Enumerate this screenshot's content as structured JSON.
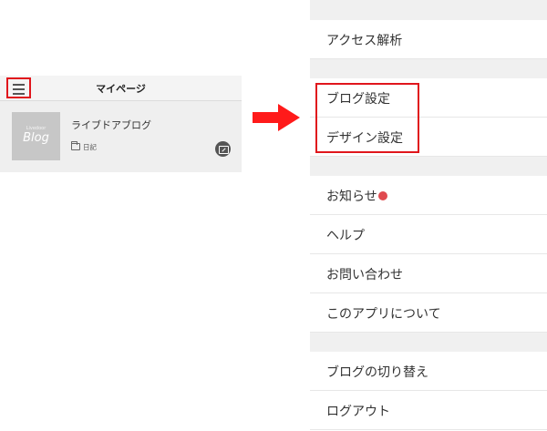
{
  "left": {
    "header_title": "マイページ",
    "blog": {
      "thumb_small_text": "Livedoor",
      "thumb_text": "Blog",
      "name": "ライブドアブログ",
      "category": "日記"
    }
  },
  "menu": {
    "items": [
      {
        "label": "アクセス解析"
      },
      {
        "label": "ブログ設定"
      },
      {
        "label": "デザイン設定"
      },
      {
        "label": "お知らせ"
      },
      {
        "label": "ヘルプ"
      },
      {
        "label": "お問い合わせ"
      },
      {
        "label": "このアプリについて"
      },
      {
        "label": "ブログの切り替え"
      },
      {
        "label": "ログアウト"
      }
    ]
  },
  "colors": {
    "highlight": "#e0161c",
    "notification_dot": "#e04a4f",
    "arrow": "#ff1a1a"
  }
}
